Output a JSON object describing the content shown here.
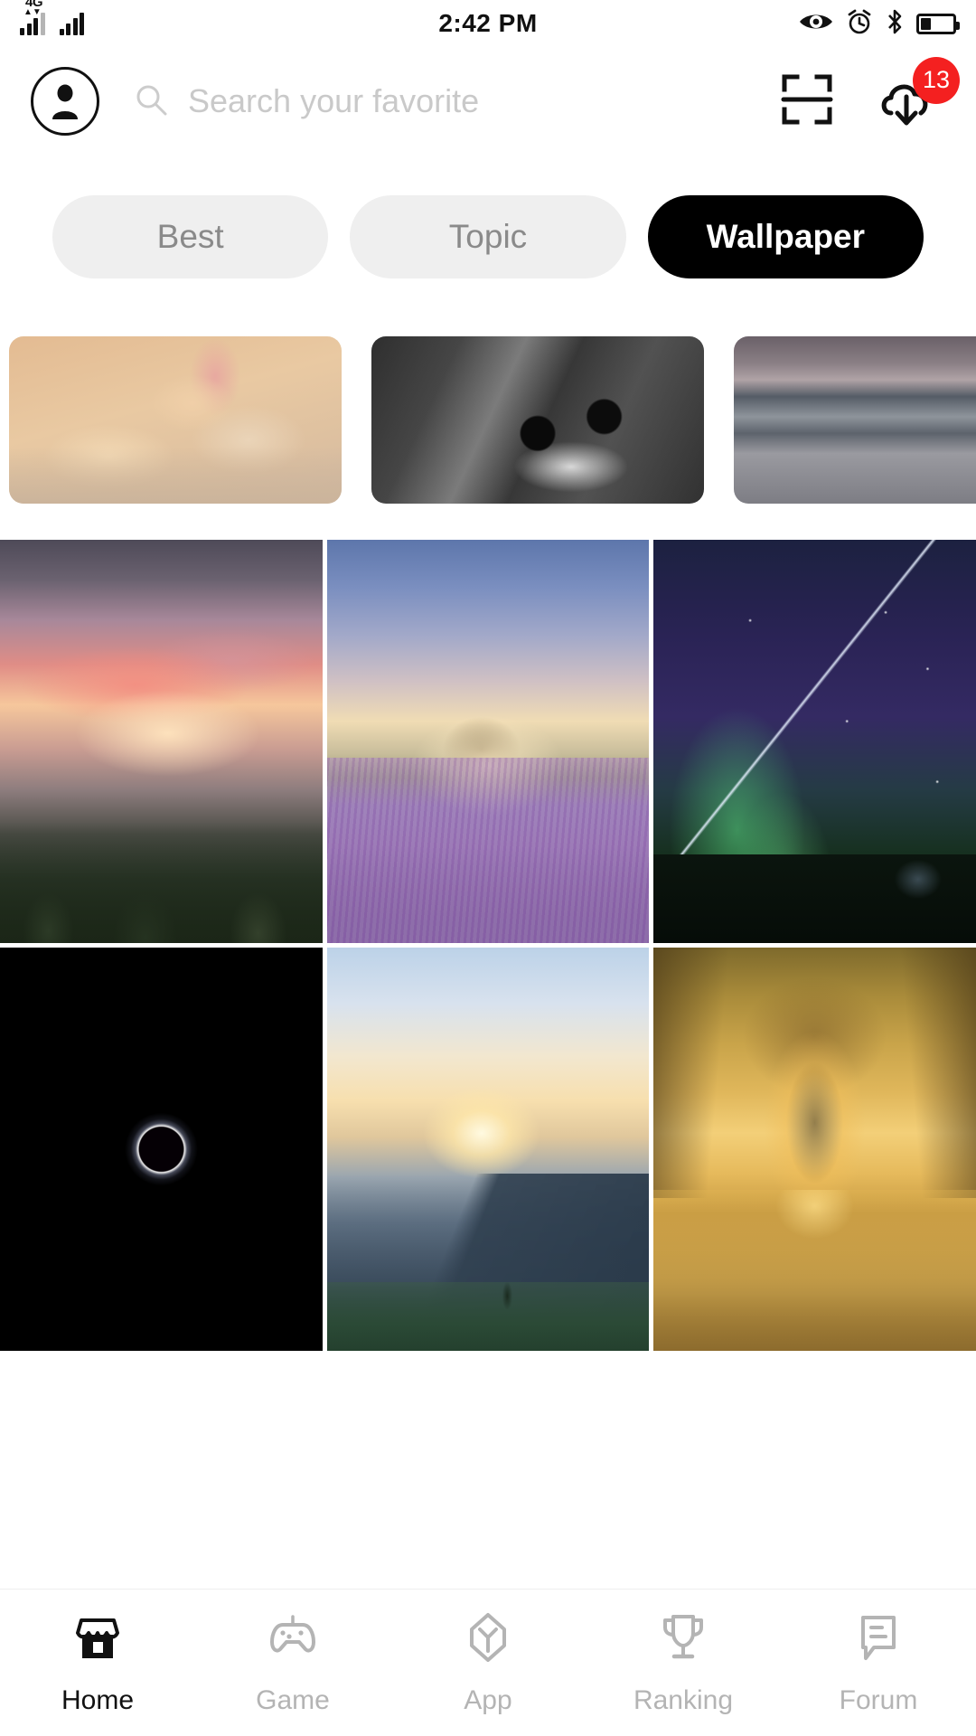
{
  "status_bar": {
    "network_label": "4G",
    "time": "2:42 PM",
    "icons": [
      "eye-care-icon",
      "alarm-clock-icon",
      "bluetooth-icon",
      "battery-icon"
    ],
    "battery_level_percent": 33
  },
  "header": {
    "avatar": "user-avatar-icon",
    "search": {
      "placeholder": "Search your favorite",
      "value": "",
      "icon": "search-icon"
    },
    "scan_icon": "scan-code-icon",
    "download": {
      "icon": "cloud-download-icon",
      "badge_count": "13",
      "badge_color": "#f42020"
    }
  },
  "tabs": {
    "items": [
      {
        "label": "Best",
        "active": false
      },
      {
        "label": "Topic",
        "active": false
      },
      {
        "label": "Wallpaper",
        "active": true
      }
    ],
    "active_color": "#000000",
    "inactive_bg": "#efefef",
    "inactive_text": "#8a8a8a"
  },
  "featured_strip": {
    "items": [
      {
        "name": "puppy-and-bunny-wallpaper"
      },
      {
        "name": "black-and-white-cat-sunglasses-wallpaper"
      },
      {
        "name": "snowy-mountain-lake-wallpaper"
      }
    ]
  },
  "wallpaper_grid": {
    "items": [
      {
        "name": "yosemite-sunset-valley-wallpaper"
      },
      {
        "name": "lavender-field-tree-sunrise-wallpaper"
      },
      {
        "name": "aurora-meteor-night-sky-wallpaper"
      },
      {
        "name": "solar-eclipse-wallpaper"
      },
      {
        "name": "lake-sunrise-mountain-silhouette-wallpaper"
      },
      {
        "name": "golden-cathedral-arches-wallpaper"
      }
    ]
  },
  "bottom_nav": {
    "items": [
      {
        "label": "Home",
        "icon": "store-icon",
        "active": true
      },
      {
        "label": "Game",
        "icon": "gamepad-icon",
        "active": false
      },
      {
        "label": "App",
        "icon": "app-cube-icon",
        "active": false
      },
      {
        "label": "Ranking",
        "icon": "trophy-icon",
        "active": false
      },
      {
        "label": "Forum",
        "icon": "speech-bubble-icon",
        "active": false
      }
    ],
    "active_color": "#111111",
    "inactive_color": "#b4b4b4"
  }
}
